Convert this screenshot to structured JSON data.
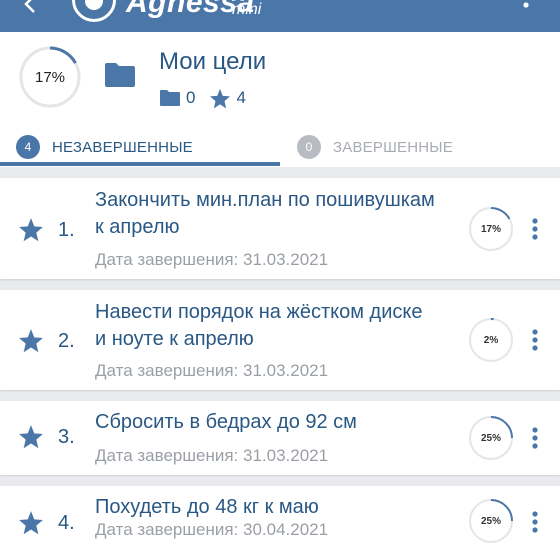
{
  "app": {
    "brand": "Agnessa",
    "brand_suffix": "mini"
  },
  "header": {
    "progress_percent": 17,
    "progress_label": "17%",
    "title": "Мои цели",
    "folders_count": "0",
    "starred_count": "4"
  },
  "tabs": [
    {
      "label": "НЕЗАВЕРШЕННЫЕ",
      "count": "4",
      "active": true
    },
    {
      "label": "ЗАВЕРШЕННЫЕ",
      "count": "0",
      "active": false
    }
  ],
  "goals": [
    {
      "index": "1.",
      "title": "Закончить мин.план по пошивушкам к апрелю",
      "date": "Дата завершения: 31.03.2021",
      "progress_label": "17%",
      "progress": 0.17
    },
    {
      "index": "2.",
      "title": "Навести порядок на жёстком диске и ноуте к апрелю",
      "date": "Дата завершения: 31.03.2021",
      "progress_label": "2%",
      "progress": 0.02
    },
    {
      "index": "3.",
      "title": "Сбросить в бедрах до 92 см",
      "date": "Дата завершения: 31.03.2021",
      "progress_label": "25%",
      "progress": 0.25
    },
    {
      "index": "4.",
      "title": "Похудеть до 48 кг к маю",
      "date": "Дата завершения: 30.04.2021",
      "progress_label": "25%",
      "progress": 0.25
    }
  ],
  "colors": {
    "primary": "#4a76a8",
    "title_text": "#2a5885",
    "muted": "#9a9fa6",
    "ring_track": "#e3e5e8"
  }
}
